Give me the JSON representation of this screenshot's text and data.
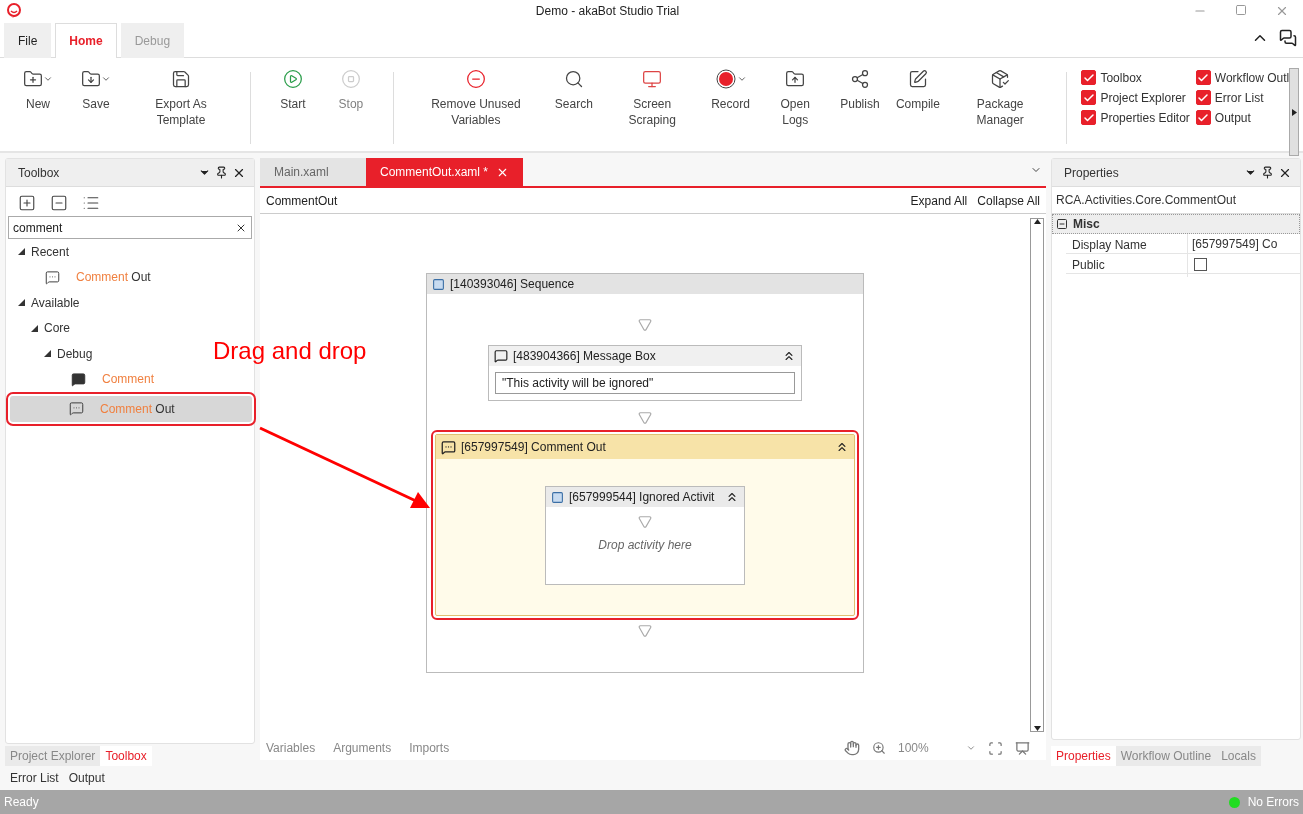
{
  "window": {
    "title": "Demo - akaBot Studio Trial"
  },
  "ribbon": {
    "tabs": [
      {
        "label": "File",
        "selected": false
      },
      {
        "label": "Home",
        "selected": true
      },
      {
        "label": "Debug",
        "selected": false
      }
    ],
    "groups": [
      [
        {
          "label": "New",
          "dropdown": true,
          "disabled": false
        },
        {
          "label": "Save",
          "dropdown": true,
          "disabled": false
        },
        {
          "label": "Export As Template",
          "dropdown": false,
          "disabled": false
        }
      ],
      [
        {
          "label": "Start",
          "dropdown": false,
          "disabled": false
        },
        {
          "label": "Stop",
          "dropdown": false,
          "disabled": true
        }
      ],
      [
        {
          "label": "Remove Unused Variables",
          "dropdown": false,
          "disabled": false
        },
        {
          "label": "Search",
          "dropdown": false,
          "disabled": false
        },
        {
          "label": "Screen Scraping",
          "dropdown": false,
          "disabled": false
        },
        {
          "label": "Record",
          "dropdown": true,
          "disabled": false
        },
        {
          "label": "Open Logs",
          "dropdown": false,
          "disabled": false
        },
        {
          "label": "Publish",
          "dropdown": false,
          "disabled": false
        },
        {
          "label": "Compile",
          "dropdown": false,
          "disabled": false
        },
        {
          "label": "Package Manager",
          "dropdown": false,
          "disabled": false
        }
      ]
    ],
    "panes": [
      {
        "label": "Toolbox",
        "checked": true
      },
      {
        "label": "Workflow Outl",
        "checked": true
      },
      {
        "label": "Project Explorer",
        "checked": true
      },
      {
        "label": "Error List",
        "checked": true
      },
      {
        "label": "Properties Editor",
        "checked": true
      },
      {
        "label": "Output",
        "checked": true
      }
    ]
  },
  "toolbox": {
    "title": "Toolbox",
    "search": {
      "value": "comment"
    },
    "tree": [
      {
        "kind": "group",
        "label": "Recent",
        "expanded": true,
        "children": [
          {
            "kind": "activity",
            "match": "Comment",
            "rest": " Out",
            "selected": false,
            "framed": false
          }
        ]
      },
      {
        "kind": "group",
        "label": "Available",
        "expanded": true,
        "children": [
          {
            "kind": "group",
            "label": "Core",
            "expanded": true,
            "children": [
              {
                "kind": "group",
                "label": "Debug",
                "expanded": true,
                "children": [
                  {
                    "kind": "activity",
                    "match": "Comment",
                    "selected": false,
                    "framed": false
                  },
                  {
                    "kind": "activity",
                    "match": "Comment",
                    "rest": " Out",
                    "selected": true,
                    "framed": true
                  }
                ]
              }
            ]
          }
        ]
      }
    ],
    "bottom_tabs": [
      {
        "label": "Project Explorer",
        "selected": false
      },
      {
        "label": "Toolbox",
        "selected": true
      }
    ],
    "bottom_tabs_2": [
      {
        "label": "Error List",
        "selected": false
      },
      {
        "label": "Output",
        "selected": false
      }
    ]
  },
  "editor": {
    "tabs": [
      {
        "label": "Main.xaml",
        "selected": false
      },
      {
        "label": "CommentOut.xaml *",
        "selected": true
      }
    ],
    "breadcrumb": "CommentOut",
    "actions": [
      "Expand All",
      "Collapse All"
    ],
    "sequence": {
      "title": "[140393046] Sequence",
      "children": [
        {
          "kind": "message",
          "title": "[483904366] Message Box",
          "value": "\"This activity will be ignored\""
        },
        {
          "kind": "comment_out",
          "title": "[657997549] Comment Out",
          "highlighted": true,
          "child": {
            "title": "[657999544] Ignored Activit",
            "hint": "Drop activity here"
          }
        }
      ]
    },
    "footer_tabs": [
      "Variables",
      "Arguments",
      "Imports"
    ],
    "zoom": "100%"
  },
  "annotation": {
    "text": "Drag and drop"
  },
  "properties": {
    "title": "Properties",
    "type": "RCA.Activities.Core.CommentOut",
    "category": {
      "label": "Misc",
      "expanded": true
    },
    "rows": [
      {
        "kind": "text",
        "name": "Display Name",
        "value": "[657997549] Co"
      },
      {
        "kind": "checkbox",
        "name": "Public",
        "checked": false
      }
    ],
    "tabs": [
      {
        "label": "Properties",
        "selected": true
      },
      {
        "label": "Workflow Outline",
        "selected": false
      },
      {
        "label": "Locals",
        "selected": false
      }
    ]
  },
  "status_bar": {
    "left": "Ready",
    "right": "No Errors"
  }
}
